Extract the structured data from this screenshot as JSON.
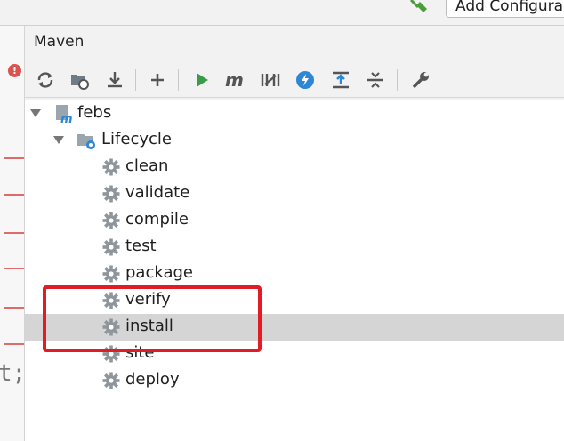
{
  "top": {
    "add_config_label": "Add Configura"
  },
  "editor": {
    "error_badge": "!",
    "code_fragment": "t;"
  },
  "maven": {
    "title": "Maven",
    "toolbar": [
      {
        "name": "reimport-icon"
      },
      {
        "name": "generate-sources-icon"
      },
      {
        "name": "download-icon"
      },
      {
        "name": "add-icon"
      },
      {
        "name": "run-icon"
      },
      {
        "name": "execute-goal-icon"
      },
      {
        "name": "toggle-offline-icon"
      },
      {
        "name": "skip-tests-icon"
      },
      {
        "name": "show-dependencies-icon"
      },
      {
        "name": "collapse-all-icon"
      },
      {
        "name": "settings-icon"
      }
    ],
    "tree": {
      "project": "febs",
      "lifecycle": "Lifecycle",
      "goals": [
        "clean",
        "validate",
        "compile",
        "test",
        "package",
        "verify",
        "install",
        "site",
        "deploy"
      ],
      "selected": "install"
    }
  }
}
